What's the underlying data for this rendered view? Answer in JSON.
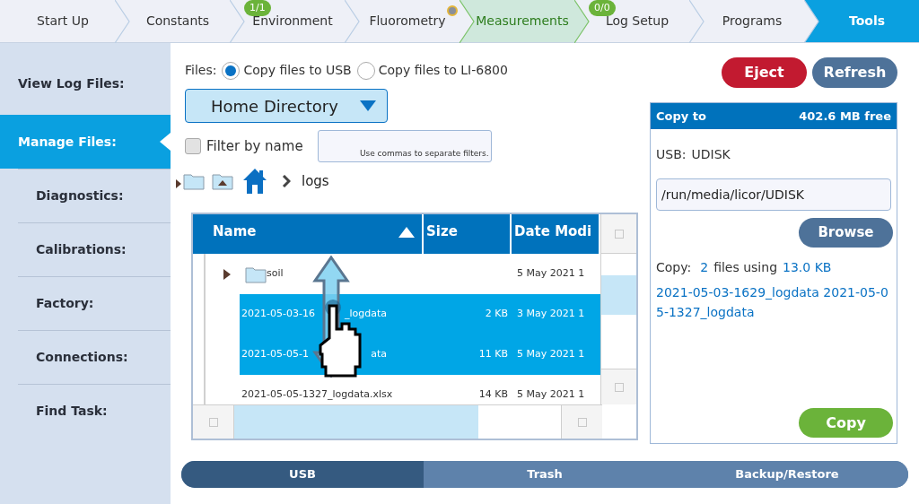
{
  "nav": {
    "tabs": [
      {
        "label": "Start Up",
        "selected": false,
        "highlighted": false
      },
      {
        "label": "Constants",
        "selected": false,
        "highlighted": false
      },
      {
        "label": "Environment",
        "selected": false,
        "highlighted": false,
        "badge": "1/1"
      },
      {
        "label": "Fluorometry",
        "selected": false,
        "highlighted": false,
        "indicator": true
      },
      {
        "label": "Measurements",
        "selected": false,
        "highlighted": true
      },
      {
        "label": "Log Setup",
        "selected": false,
        "highlighted": false,
        "badge": "0/0"
      },
      {
        "label": "Programs",
        "selected": false,
        "highlighted": false
      },
      {
        "label": "Tools",
        "selected": true,
        "highlighted": false
      }
    ]
  },
  "sidebar": {
    "items": [
      {
        "label": "View Log Files:",
        "selected": false
      },
      {
        "label": "Manage Files:",
        "selected": true
      },
      {
        "label": "Diagnostics:",
        "selected": false
      },
      {
        "label": "Calibrations:",
        "selected": false
      },
      {
        "label": "Factory:",
        "selected": false
      },
      {
        "label": "Connections:",
        "selected": false
      },
      {
        "label": "Find Task:",
        "selected": false
      }
    ]
  },
  "files": {
    "label": "Files:",
    "options": [
      {
        "label": "Copy files to USB",
        "selected": true
      },
      {
        "label": "Copy files to LI-6800",
        "selected": false
      }
    ]
  },
  "directory": {
    "value": "Home Directory"
  },
  "filter": {
    "label": "Filter by name",
    "checked": false,
    "placeholder": "Use commas to separate filters."
  },
  "breadcrumb": {
    "current": "logs"
  },
  "table": {
    "columns": [
      {
        "label": "Name",
        "sorted": true
      },
      {
        "label": "Size",
        "sorted": false
      },
      {
        "label": "Date Modi",
        "sorted": false
      }
    ],
    "rows": [
      {
        "kind": "folder",
        "name_parts": [
          "soil"
        ],
        "size": "",
        "date": "5 May 2021 1",
        "selected": false
      },
      {
        "kind": "file",
        "name_parts": [
          "2021-05-03-16",
          "_logdata"
        ],
        "size": "2 KB",
        "date": "3 May 2021 1",
        "selected": true
      },
      {
        "kind": "file",
        "name_parts": [
          "2021-05-05-1",
          "ata"
        ],
        "size": "11 KB",
        "date": "5 May 2021 1",
        "selected": true
      },
      {
        "kind": "file",
        "name_parts": [
          "2021-05-05-1327_logdata.xlsx"
        ],
        "size": "14 KB",
        "date": "5 May 2021 1",
        "selected": false
      }
    ]
  },
  "actions": {
    "eject": "Eject",
    "refresh": "Refresh"
  },
  "copy_panel": {
    "title": "Copy to",
    "free": "402.6 MB free",
    "usb_label": "USB:",
    "usb_name": "UDISK",
    "path": "/run/media/licor/UDISK",
    "browse": "Browse",
    "summary_label": "Copy:",
    "count": "2",
    "count_text": "files using",
    "size": "13.0 KB",
    "file_list": "2021-05-03-1629_logdata 2021-05-05-1327_logdata",
    "copy": "Copy"
  },
  "bottom_tabs": [
    {
      "label": "USB",
      "selected": true
    },
    {
      "label": "Trash",
      "selected": false
    },
    {
      "label": "Backup/Restore",
      "selected": false
    }
  ]
}
